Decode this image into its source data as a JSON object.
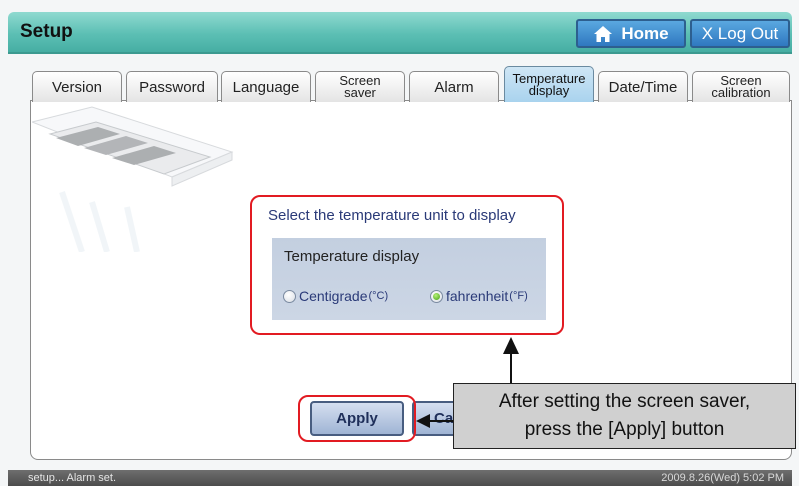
{
  "header": {
    "title": "Setup",
    "home_label": "Home",
    "logout_label": "X Log Out"
  },
  "tabs": [
    {
      "label": "Version"
    },
    {
      "label": "Password"
    },
    {
      "label": "Language"
    },
    {
      "label": "Screen",
      "label2": "saver"
    },
    {
      "label": "Alarm"
    },
    {
      "label": "Temperature",
      "label2": "display",
      "active": true
    },
    {
      "label": "Date/Time"
    },
    {
      "label": "Screen",
      "label2": "calibration"
    }
  ],
  "temperature": {
    "prompt": "Select the temperature unit to display",
    "option_title": "Temperature display",
    "options": [
      {
        "label": "Centigrade",
        "unit": "(°C)",
        "selected": false
      },
      {
        "label": "fahrenheit",
        "unit": "(°F)",
        "selected": true
      }
    ]
  },
  "buttons": {
    "apply": "Apply",
    "cancel": "Ca"
  },
  "callout": {
    "line1": "After setting the screen saver,",
    "line2": "press the [Apply] button"
  },
  "status": {
    "left": "setup... Alarm set.",
    "right": "2009.8.26(Wed)  5:02 PM"
  },
  "colors": {
    "header": "#5cbfb4",
    "highlight": "#e21b22",
    "active_tab": "#a9d3ee",
    "selected_radio": "#42a012"
  }
}
